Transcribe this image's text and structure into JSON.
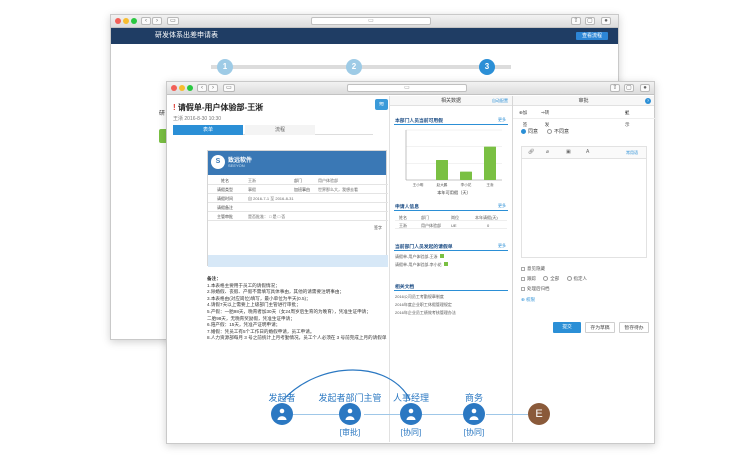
{
  "back_window": {
    "header_title": "研发体系出差申请表",
    "header_button": "查看流程",
    "steps": [
      "1",
      "2",
      "3"
    ],
    "side_label": "研"
  },
  "front_window": {
    "form_title": "请假单-用户体验部-王淅",
    "subtitle": "王淅  2016-8-30 10:30",
    "tabs": [
      "表单",
      "流程"
    ],
    "logo": {
      "cn": "致远软件",
      "en": "SEEYON"
    },
    "form_rows": [
      {
        "label": "姓名",
        "value": "王淅",
        "label2": "部门",
        "value2": "用户体验部"
      },
      {
        "label": "请假类型",
        "value": "事假",
        "label2": "加班事由",
        "value2": "世界那么大，我想去看"
      },
      {
        "label": "请假时间",
        "value": "自 2016-7-1 至 2016-8-31",
        "label2": "",
        "value2": ""
      },
      {
        "label": "请假备注",
        "value": "",
        "label2": "",
        "value2": ""
      },
      {
        "label": "主管审批",
        "value": "是否批准：  □ 是    □ 否",
        "label2": "",
        "value2": ""
      }
    ],
    "form_sign": "签字",
    "notes_title": "备注：",
    "notes": [
      "1.本表格主要用于员工的请假情况；",
      "2.除婚假、丧假、产假不需填写具体事由，其他的请需要注明事由；",
      "3.本表格由(对应岗位)填写，最小单位为半天(0.5)；",
      "4.请假7天以上需要上上级部门主管进行审批；",
      "5.产假：一胎98天，晚育者加30天（女24周岁后生育的为晚育），凭准生证申请；",
      "     二胎98天，无晚育奖励假，凭准生证申请；",
      "6.陪产假：15天，凭准产证明申请；",
      "7.婚假：凭员工有5个工作日的婚假申请，员工申请。",
      "8.人力资源部每月 3 号之前统计上月考勤情况，员工个人必须在 3 号前完成上月的请假单"
    ]
  },
  "mid_pane": {
    "title": "相关数据",
    "more_top": "自动配置",
    "chart_section_title": "本部门人员当前可用假",
    "more": "更多",
    "application_title": "申请人信息",
    "app_headers": [
      "姓名",
      "部门",
      "岗位",
      "本年请假(天)"
    ],
    "app_row": [
      "王淅",
      "用户体验部",
      "UE",
      "0"
    ],
    "related_title": "当前部门人员发起的请假单",
    "related_items": [
      "请假单-用户体验部-王淅",
      "请假单-用户体验部-李小花"
    ],
    "docs_title": "相关文档",
    "docs": [
      "2016公司员工考勤规章制度",
      "2016年度企业职工休假管理规定",
      "2016年企业员工绩效考核管理办法"
    ]
  },
  "chart_data": {
    "type": "bar",
    "title": "本部门人员当前可用假",
    "xlabel": "本年可用假（天）",
    "categories": [
      "王小明",
      "赵大鹏",
      "李小花",
      "王淅"
    ],
    "values": [
      0,
      12,
      5,
      20
    ],
    "ylim": [
      0,
      30
    ],
    "color": "#7ac043"
  },
  "right_pane": {
    "title": "审批",
    "help": "?",
    "toolbar_items": [
      "加签",
      "转发",
      "显示"
    ],
    "options": [
      "同意",
      "不同意"
    ],
    "editor_tools": [
      "附件",
      "关联",
      "格式",
      "字体",
      "常用语"
    ],
    "checkbox_opts": [
      "意见隐藏",
      "跟踪",
      "全部",
      "指定人",
      "处理后归档"
    ],
    "more_link": "权限",
    "buttons": [
      "提交",
      "存为草稿",
      "暂存待办"
    ]
  },
  "flow": {
    "nodes": [
      {
        "label": "发起者",
        "tag": ""
      },
      {
        "label": "发起者部门主管",
        "tag": "[审批]"
      },
      {
        "label": "人事经理",
        "tag": "[协同]"
      },
      {
        "label": "商务",
        "tag": "[协同]"
      }
    ],
    "end_label": "E"
  },
  "colors": {
    "accent": "#2b8fd6",
    "header": "#1f3d64",
    "chart": "#7ac043"
  }
}
